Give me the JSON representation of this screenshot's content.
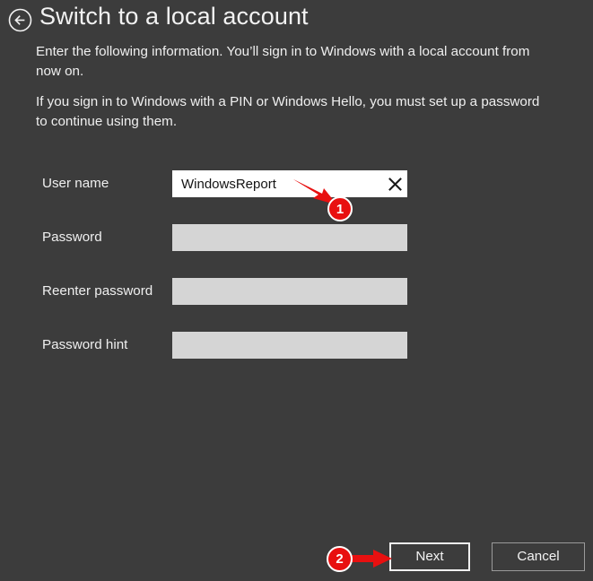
{
  "window": {
    "background_color": "#3c3c3c",
    "text_color": "#efefef"
  },
  "header": {
    "back_icon": "back-arrow-circle-icon",
    "title": "Switch to a local account"
  },
  "body_text": {
    "paragraph_1": "Enter the following information. You’ll sign in to Windows with a local account from now on.",
    "paragraph_2": "If you sign in to Windows with a PIN or Windows Hello, you must set up a password to continue using them."
  },
  "form": {
    "fields": [
      {
        "label": "User name",
        "value": "WindowsReport",
        "placeholder": "",
        "focused": true,
        "has_clear_button": true,
        "clear_icon": "close-x-icon",
        "type": "text",
        "background_color": "#ffffff"
      },
      {
        "label": "Password",
        "value": "",
        "placeholder": "",
        "focused": false,
        "has_clear_button": false,
        "type": "password",
        "background_color": "#d5d5d5"
      },
      {
        "label": "Reenter password",
        "value": "",
        "placeholder": "",
        "focused": false,
        "has_clear_button": false,
        "type": "password",
        "background_color": "#d5d5d5"
      },
      {
        "label": "Password hint",
        "value": "",
        "placeholder": "",
        "focused": false,
        "has_clear_button": false,
        "type": "text",
        "background_color": "#d5d5d5"
      }
    ]
  },
  "footer": {
    "next_label": "Next",
    "cancel_label": "Cancel"
  },
  "annotations": {
    "accent_color": "#e81010",
    "markers": [
      {
        "number": "1",
        "target": "user-name-field"
      },
      {
        "number": "2",
        "target": "next-button"
      }
    ]
  }
}
